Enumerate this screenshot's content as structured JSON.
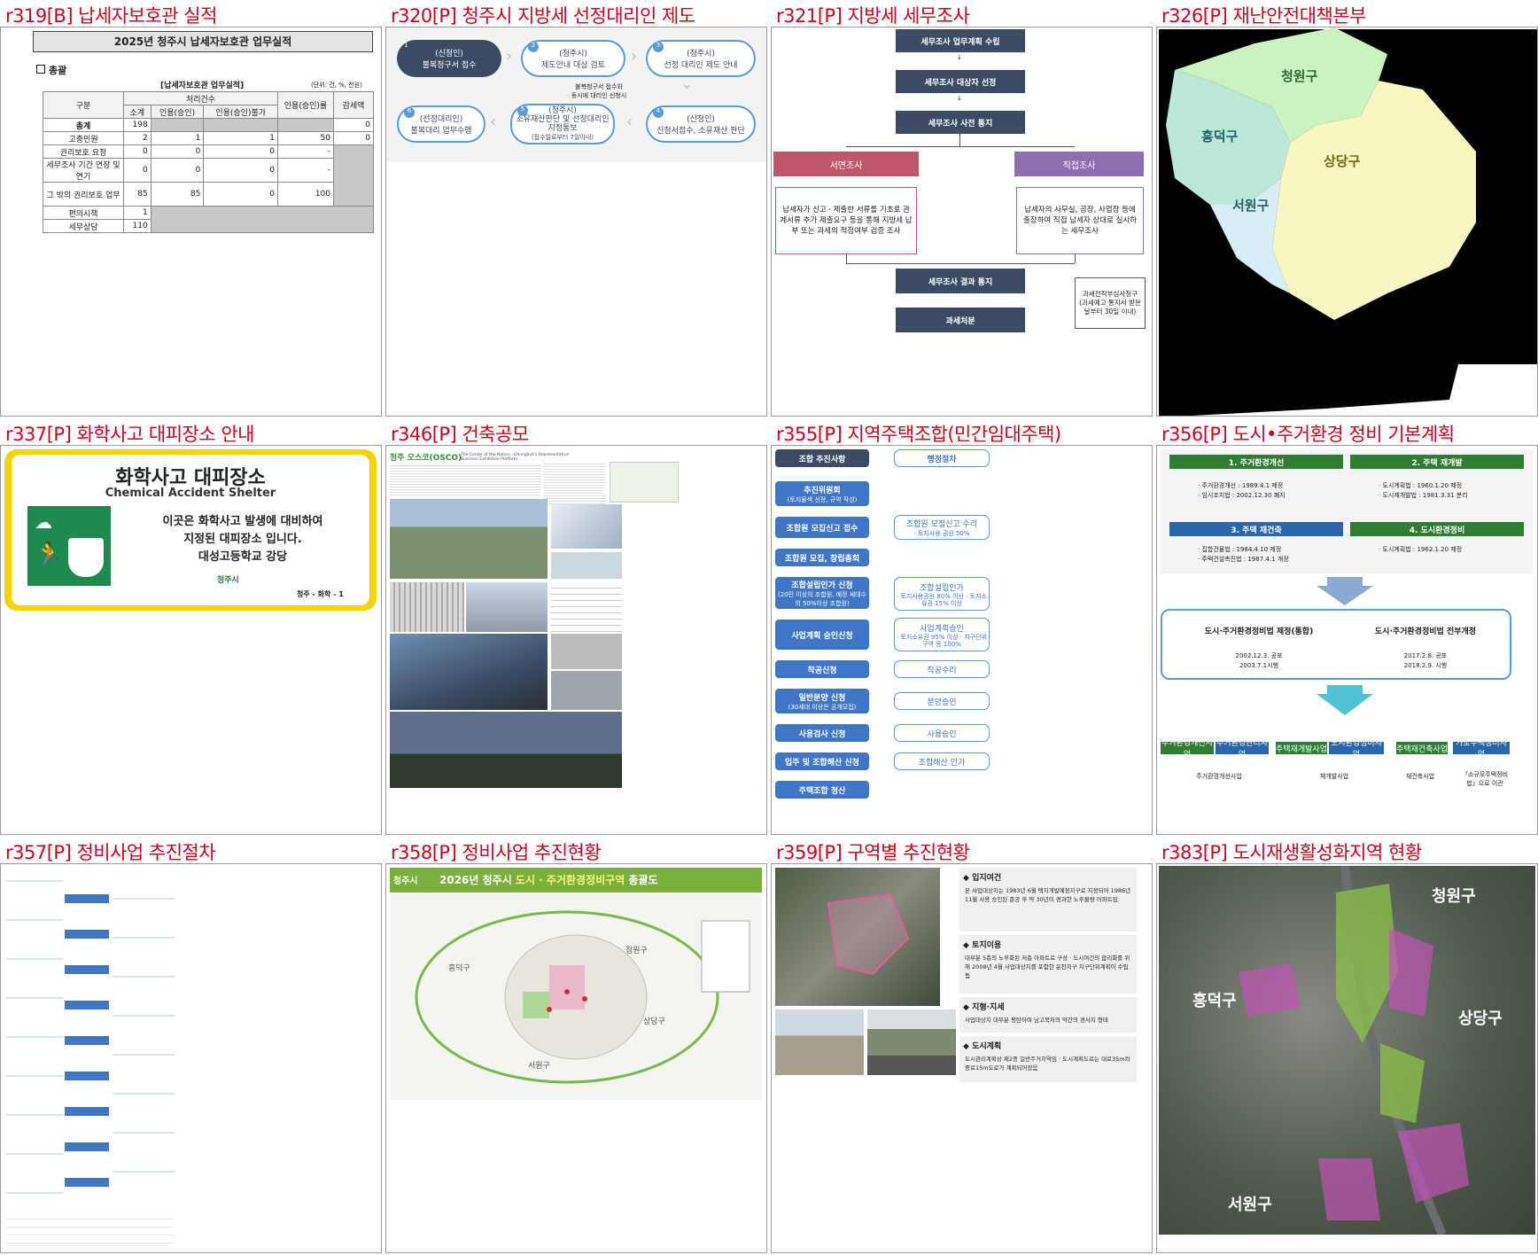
{
  "titles": {
    "r319": "r319[B] 납세자보호관 실적",
    "r320": "r320[P] 청주시 지방세 선정대리인 제도",
    "r321": "r321[P] 지방세 세무조사",
    "r326": "r326[P] 재난안전대책본부",
    "r337": "r337[P] 화학사고 대피장소 안내",
    "r346": "r346[P] 건축공모",
    "r355": "r355[P] 지역주택조합(민간임대주택)",
    "r356": "r356[P] 도시•주거환경 정비 기본계획",
    "r357": "r357[P] 정비사업 추진절차",
    "r358": "r358[P] 정비사업 추진현황",
    "r359": "r359[P] 구역별 추진현황",
    "r383": "r383[P] 도시재생활성화지역 현황"
  },
  "r319": {
    "heading": "2025년 청주시 납세자보호관 업무실적",
    "section": "총괄",
    "table_title": "[납세자보호관 업무실적]",
    "unit": "(단위: 건, %, 천원)",
    "h_gubun": "구분",
    "h_cheori": "처리건수",
    "h_sogye": "소계",
    "h_inyong": "인용(승인)",
    "h_bul": "인용(승인)불가",
    "h_rate": "인용(승인)률",
    "h_gam": "감세액",
    "rows": [
      {
        "name": "총계",
        "sogye": "198",
        "inyong": "",
        "bul": "",
        "rate": "",
        "gam": "0"
      },
      {
        "name": "고충민원",
        "sogye": "2",
        "inyong": "1",
        "bul": "1",
        "rate": "50",
        "gam": "0"
      },
      {
        "name": "권리보호 요청",
        "sogye": "0",
        "inyong": "0",
        "bul": "0",
        "rate": "-",
        "gam": ""
      },
      {
        "name": "세무조사 기간 연장 및 연기",
        "sogye": "0",
        "inyong": "0",
        "bul": "0",
        "rate": "-",
        "gam": ""
      },
      {
        "name": "그 밖의 권리보호 업무",
        "sogye": "85",
        "inyong": "85",
        "bul": "0",
        "rate": "100",
        "gam": ""
      },
      {
        "name": "편의시책",
        "sogye": "1",
        "inyong": "",
        "bul": "",
        "rate": "",
        "gam": ""
      },
      {
        "name": "세무상담",
        "sogye": "110",
        "inyong": "",
        "bul": "",
        "rate": "",
        "gam": ""
      }
    ]
  },
  "r320": {
    "steps": [
      {
        "n": "1",
        "t1": "(신청인)",
        "t2": "불복청구서 접수"
      },
      {
        "n": "2",
        "t1": "(청주시)",
        "t2": "제도안내 대상 검토"
      },
      {
        "n": "3",
        "t1": "(청주시)",
        "t2": "선정 대리인 제도 안내"
      },
      {
        "n": "4",
        "t1": "(신청인)",
        "t2": "신청서접수, 소유재산 판단"
      },
      {
        "n": "5",
        "t1": "(청주시)",
        "t2": "소유재산판단 및 선정대리인 지정통보",
        "t3": "(접수일로부터 7일이내)"
      },
      {
        "n": "6",
        "t1": "(선정대리인)",
        "t2": "불복대리 업무수행"
      }
    ],
    "note1": "불복청구서 접수와",
    "note2": "동시에 대리인 신청시"
  },
  "r321": {
    "b1": "세무조사 업무계획 수립",
    "b2": "세무조사 대상자 선정",
    "b3": "세무조사 사전 통지",
    "left_head": "서면조사",
    "left_body": "납세자가 신고ㆍ제출한 서류를 기초로 관계서류 추가 제출요구 등을 통해 지방세 납부 또는 과세의 적정여부 검증 조사",
    "right_head": "직접조사",
    "right_body": "납세자의 사무실, 공장, 사업장 등에 출장하여 직접 납세자 상대로 실시하는 세무조사",
    "b4": "세무조사 결과 통지",
    "b5": "과세처분",
    "side": "과세전적부심사청구 (과세예고 통지서 받은날부터 30일 이내)"
  },
  "r326": {
    "d1": "청원구",
    "d2": "흥덕구",
    "d3": "상당구",
    "d4": "서원구"
  },
  "r337": {
    "title_ko": "화학사고 대피장소",
    "title_en": "Chemical Accident Shelter",
    "line1": "이곳은 화학사고 발생에 대비하여",
    "line2": "지정된 대피장소 입니다.",
    "line3": "대성고등학교 강당",
    "logo": "청주시",
    "code": "청주 - 화학 - 1"
  },
  "r346": {
    "header": "청주 오스코(OSCO)",
    "sub": "The Center of the Nation : Chungbuk's Representative Business Exhibition Platform"
  },
  "r355": {
    "left_head": "조합 추진사항",
    "right_head": "행정절차",
    "left": [
      {
        "t": "추진위원회",
        "s": "(토지물색 선정, 규약 작성)"
      },
      {
        "t": "조합원 모집신고 접수",
        "s": ""
      },
      {
        "t": "조합원 모집, 창립총회",
        "s": ""
      },
      {
        "t": "조합설립인가 신청",
        "s": "(20인 이상의 조합원, 예정 세대수의 50%이상 조합원)"
      },
      {
        "t": "사업계획 승인신청",
        "s": ""
      },
      {
        "t": "착공신청",
        "s": ""
      },
      {
        "t": "일반분양 신청",
        "s": "(30세대 이상은 공개모집)"
      },
      {
        "t": "사용검사 신청",
        "s": ""
      },
      {
        "t": "입주 및 조합해산 신청",
        "s": ""
      },
      {
        "t": "주택조합 청산",
        "s": ""
      }
    ],
    "right": [
      {
        "t": "조합원 모집신고 수리",
        "s": "· 토지사용 권원 50%"
      },
      {
        "t": "조합설립인가",
        "s": "· 토지사용권원 80% 이상 · 토지소유권 15% 이상"
      },
      {
        "t": "사업계획승인",
        "s": "· 토지소유권 95% 이상 · 지구단위구역 등 100%"
      },
      {
        "t": "착공수리",
        "s": ""
      },
      {
        "t": "분양승인",
        "s": ""
      },
      {
        "t": "사용승인",
        "s": ""
      },
      {
        "t": "조합해산 인가",
        "s": ""
      }
    ]
  },
  "r356": {
    "h1": "1. 주거환경개선",
    "h1a": "· 주거환경개선 : 1989.4.1 제정",
    "h1b": "· 임시조치법 : 2002.12.30 폐지",
    "h2": "2. 주택 재개발",
    "h2a": "· 도시계획법 : 1960.1.20 제정",
    "h2b": "· 도시재개발법 : 1981.3.31 분리",
    "h3": "3. 주택 재건축",
    "h3a": "· 집합건물법 : 1984.4.10 제정",
    "h3b": "· 주택건설촉진법 : 1987.4.1 개정",
    "h4": "4. 도시환경정비",
    "h4a": "· 도시계획법 : 1962.1.20 제정",
    "m1": "도시·주거환경정비법 제정(통합)",
    "m1a": "2002.12.3. 공포",
    "m1b": "2003.7.1시행",
    "m2": "도시·주거환경정비법 전부개정",
    "m2a": "2017.2.8. 공포",
    "m2b": "2018.2.9. 시행",
    "b1": "주거환경개선사업",
    "b2": "주거환경관리사업",
    "b3": "주택재개발사업",
    "b4": "도시환경정비사업",
    "b5": "주택재건축사업",
    "b6": "가로주택정비사업",
    "r1": "주거환경개선사업",
    "r2": "재개발사업",
    "r3": "재건축사업",
    "r4": "『소규모주택정비법』으로 이관"
  },
  "r358": {
    "title_a": "2026년 청주시 ",
    "title_b": "도시 · 주거환경정비구역",
    "title_c": " 총괄도",
    "logo": "청주시",
    "g1": "흥덕구",
    "g2": "청원구",
    "g3": "상당구",
    "g4": "서원구"
  },
  "r359": {
    "s1": "입지여건",
    "s1t": "본 사업대상지는 1983년 6월 택지개발예정지구로 지정되어 1986년 11월 사용 승인된 준공 후 약 30년이 경과한 노후불량 아파트임",
    "s2": "토지이용",
    "s2t": "대부분 5층의 노후화된 저층 아파트로 구성 · 도시여건의 합리화를 위해 2008년 4월 사업대상지를 포함한 운천지구 지구단위계획이 수립됨",
    "s3": "지형·지세",
    "s3t": "사업대상지 대부분 평탄하며 남고북저의 약간의 경사지 형태",
    "s4": "도시계획",
    "s4t": "도시관리계획상 제2종 일반주거지역임 · 도시계획도로는 대로35m와 중로15m도로가 계획되어있음"
  },
  "r383": {
    "g1": "청원구",
    "g2": "흥덕구",
    "g3": "상당구",
    "g4": "서원구"
  },
  "colors": {
    "title_red": "#d0021b",
    "navy": "#3c4a66",
    "flow_blue": "#3f76c6",
    "seoga_pink": "#c0566c",
    "jikjeop_purple": "#8b6fb0",
    "sign_yellow": "#f4d400",
    "sign_green": "#1d8a4f",
    "plan_green": "#2e7d32",
    "plan_blue": "#2a66ae"
  }
}
